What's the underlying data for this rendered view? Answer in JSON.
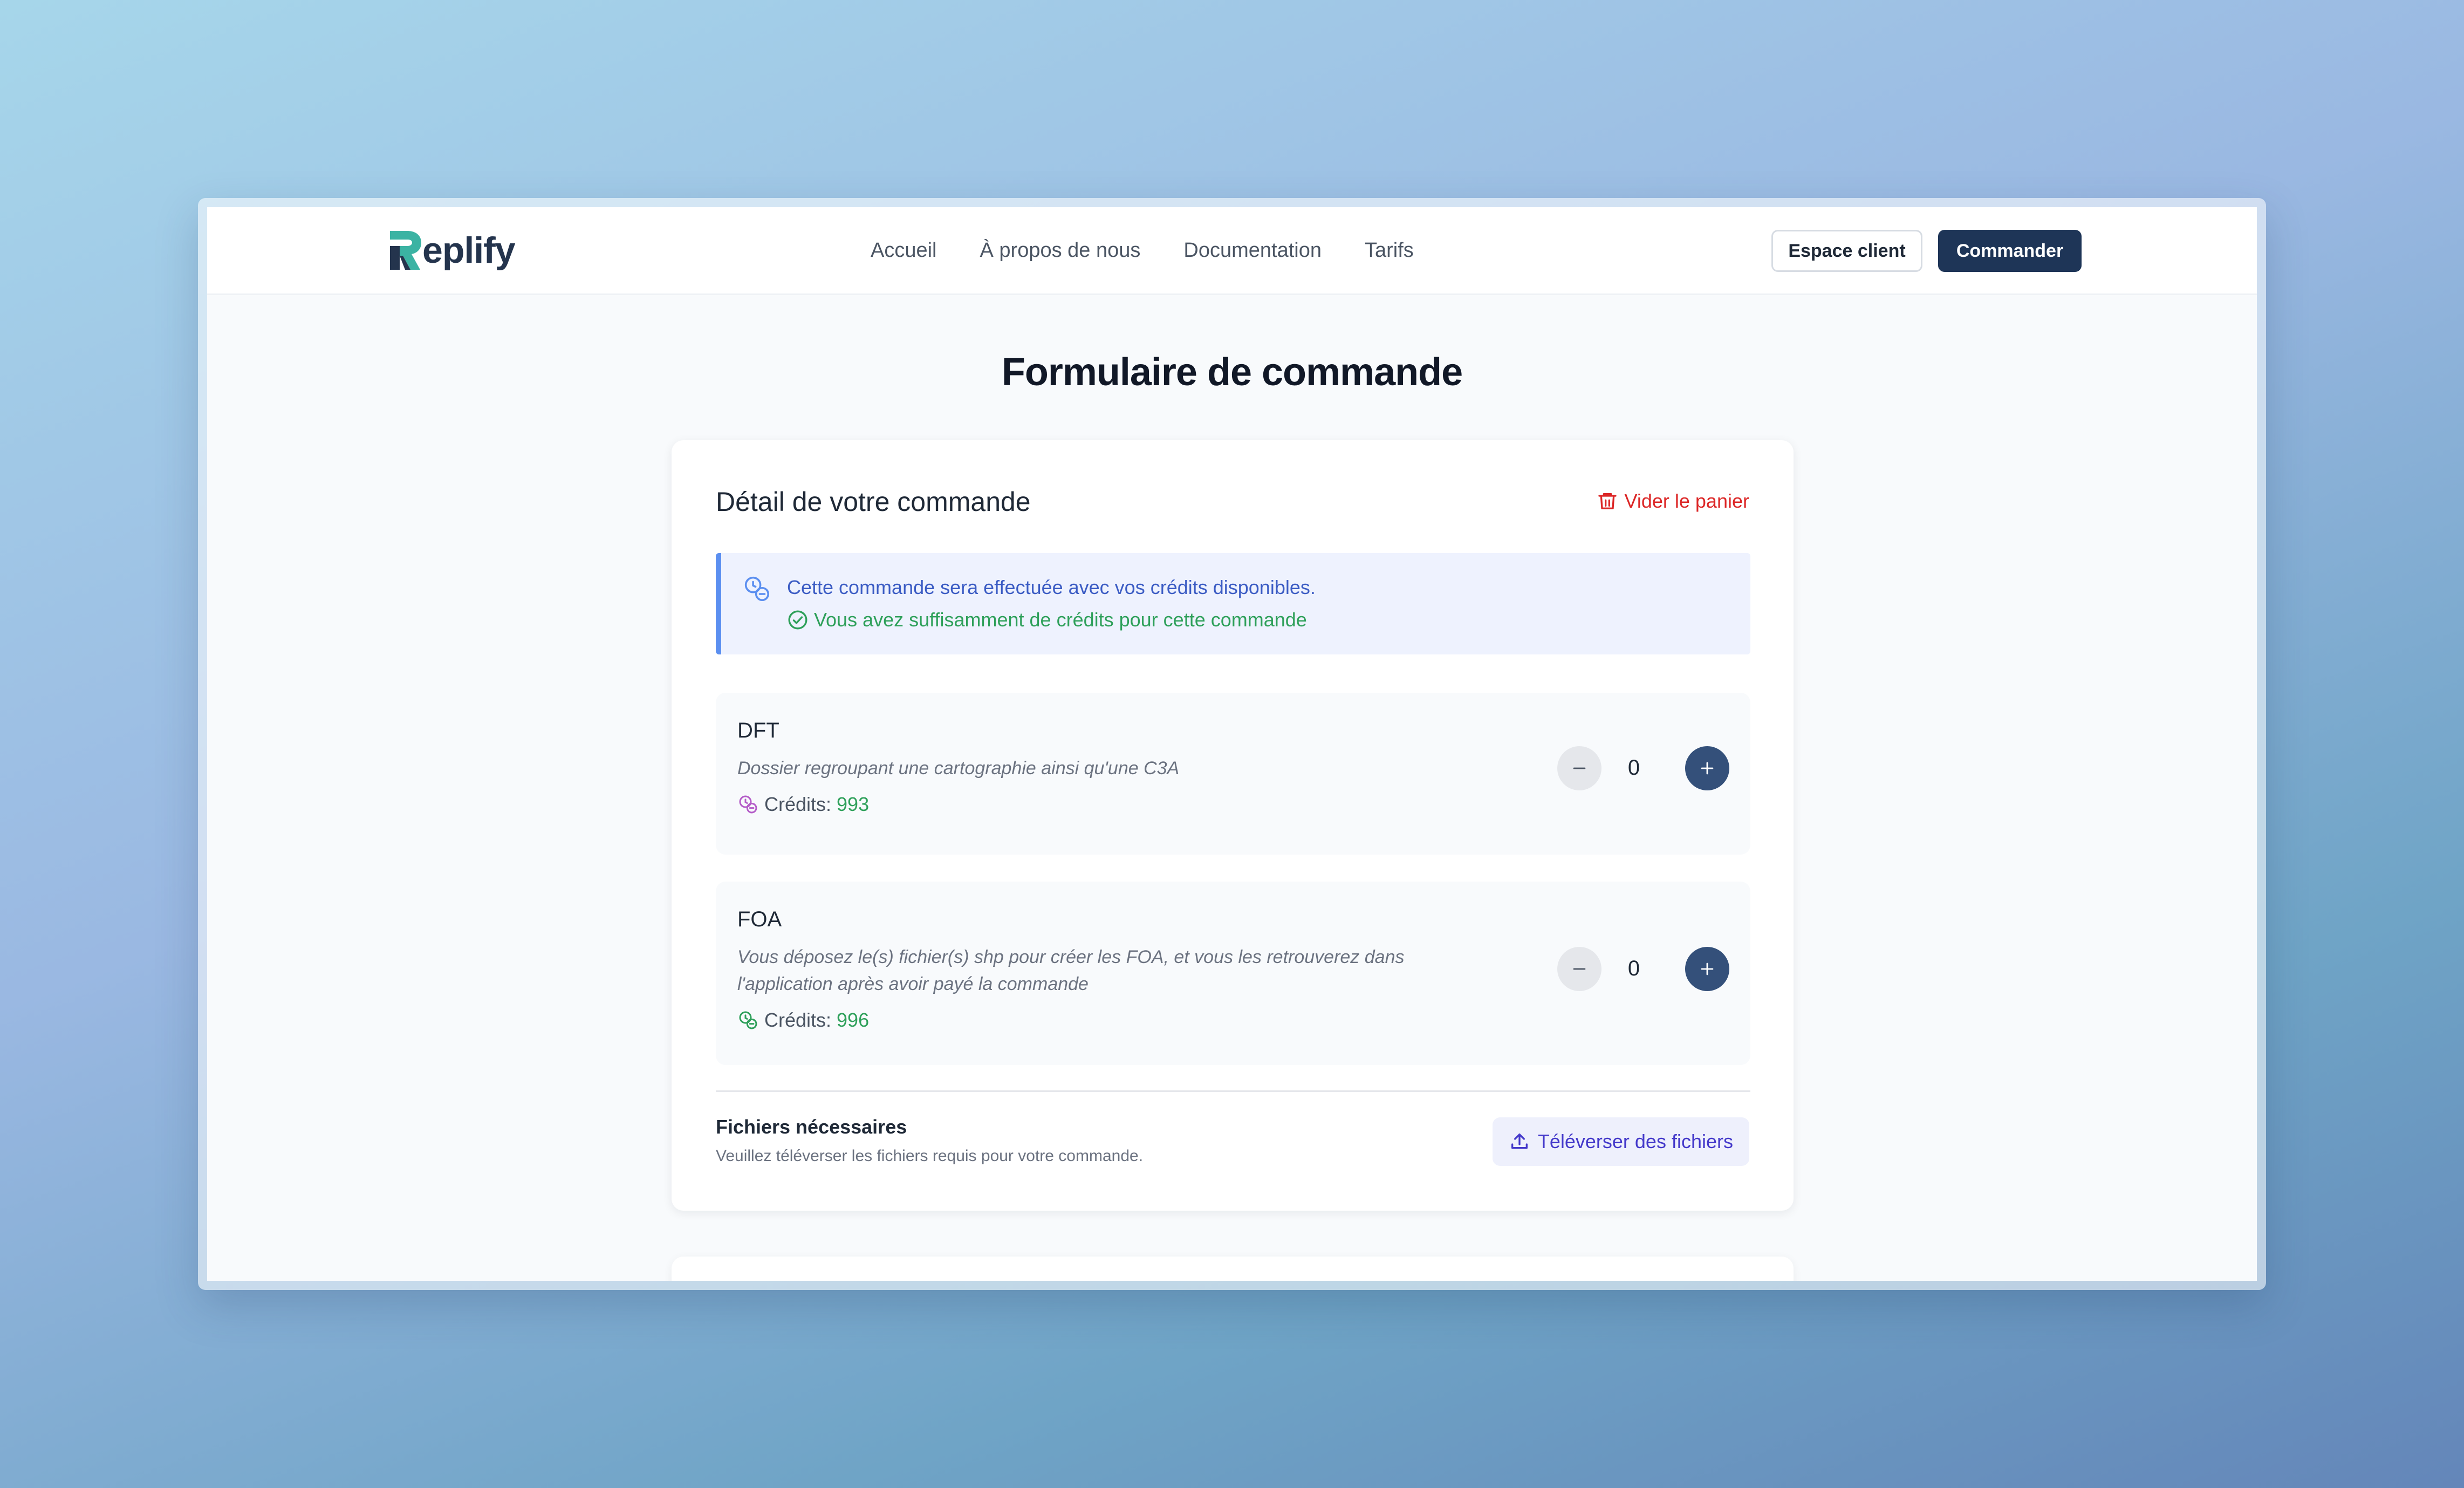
{
  "header": {
    "logo_text": "eplify",
    "nav": [
      "Accueil",
      "À propos de nous",
      "Documentation",
      "Tarifs"
    ],
    "client_button": "Espace client",
    "order_button": "Commander"
  },
  "page": {
    "title": "Formulaire de commande"
  },
  "order_card": {
    "title": "Détail de votre commande",
    "empty_cart": "Vider le panier",
    "info": {
      "message": "Cette commande sera effectuée avec vos crédits disponibles.",
      "status": "Vous avez suffisamment de crédits pour cette commande"
    },
    "products": [
      {
        "name": "DFT",
        "description": "Dossier regroupant une cartographie ainsi qu'une C3A",
        "credits_label": "Crédits:",
        "credits": "993",
        "quantity": "0"
      },
      {
        "name": "FOA",
        "description": "Vous déposez le(s) fichier(s) shp pour créer les FOA, et vous les retrouverez dans l'application après avoir payé la commande",
        "credits_label": "Crédits:",
        "credits": "996",
        "quantity": "0"
      }
    ],
    "files": {
      "title": "Fichiers nécessaires",
      "subtitle": "Veuillez téléverser les fichiers requis pour votre commande.",
      "upload_button": "Téléverser des fichiers"
    }
  },
  "colors": {
    "brand_dark": "#1e3557",
    "brand_teal": "#3bb3a3",
    "danger": "#dc2626",
    "success": "#2ea05a",
    "info": "#3b5cc4"
  },
  "icons": {
    "empty_cart": "trash-icon",
    "info": "coins-icon",
    "status": "check-circle-icon",
    "credits": "coins-icon",
    "minus": "minus-icon",
    "plus": "plus-icon",
    "upload": "upload-icon"
  }
}
